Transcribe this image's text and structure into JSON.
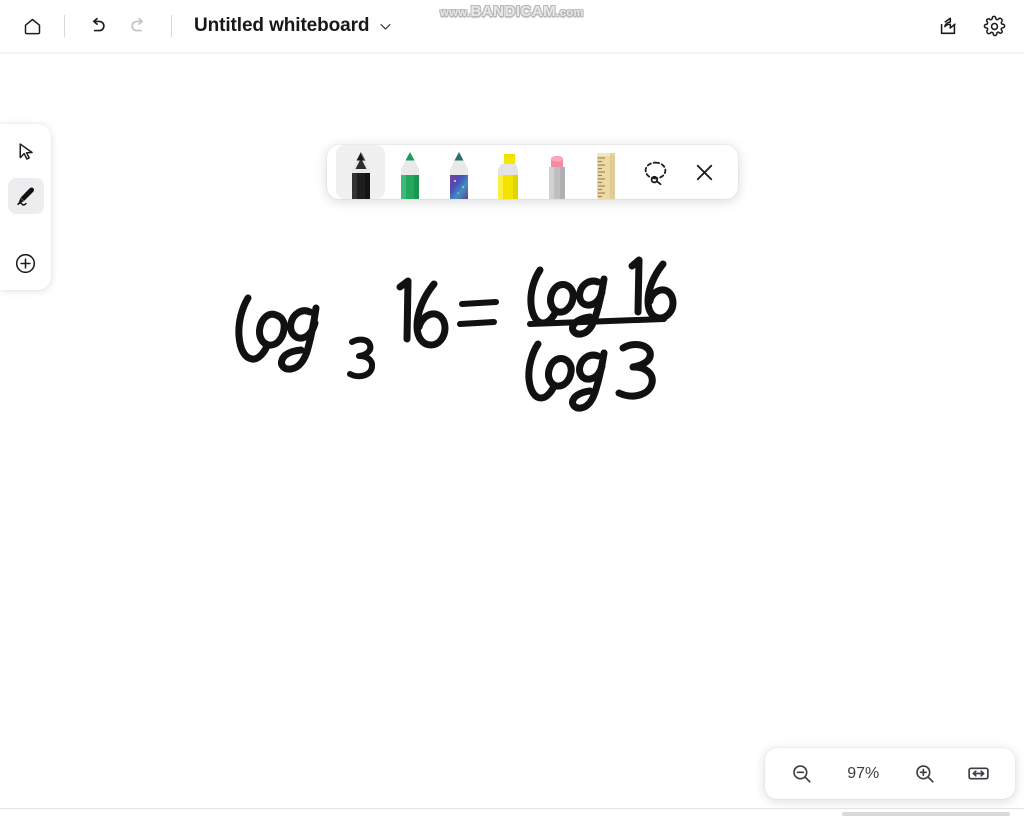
{
  "app": {
    "title": "Untitled whiteboard",
    "background_color": "#ffffff",
    "accent_color": "#18181b"
  },
  "watermark": {
    "prefix": "www.",
    "brand": "BANDICAM",
    "suffix": ".com",
    "full_text": "www.BANDICAM.com"
  },
  "header": {
    "home_label": "Home",
    "undo_label": "Undo",
    "redo_label": "Redo",
    "title": "Untitled whiteboard",
    "title_dropdown_label": "Document menu",
    "share_label": "Share",
    "settings_label": "Settings"
  },
  "sidebar": {
    "items": [
      {
        "name": "select",
        "label": "Select",
        "icon": "cursor-icon",
        "active": false
      },
      {
        "name": "pen",
        "label": "Pen",
        "icon": "pen-icon",
        "active": true
      },
      {
        "name": "add",
        "label": "Add",
        "icon": "plus-circle-icon",
        "active": false
      }
    ]
  },
  "pen_toolbar": {
    "tools": [
      {
        "name": "black-pen",
        "label": "Black pen",
        "type": "pen",
        "color": "#1c1c1c",
        "selected": true
      },
      {
        "name": "green-pen",
        "label": "Green pen",
        "type": "pen",
        "color": "#1f9d55",
        "selected": false
      },
      {
        "name": "galaxy-pen",
        "label": "Galaxy pen",
        "type": "pen",
        "color": "#5b4b9e",
        "selected": false
      },
      {
        "name": "yellow-highlighter",
        "label": "Yellow highlighter",
        "type": "highlighter",
        "color": "#f2e205",
        "selected": false
      },
      {
        "name": "eraser",
        "label": "Eraser",
        "type": "eraser",
        "color": "#f48fa0",
        "selected": false
      },
      {
        "name": "ruler",
        "label": "Ruler",
        "type": "ruler",
        "color": "#e8d4a0",
        "selected": false
      }
    ],
    "lasso_label": "Lasso select",
    "close_label": "Close toolbar"
  },
  "canvas": {
    "ink_color": "#111111",
    "content_description": "handwritten equation",
    "equation_text": "log₃ 16 = log 16 / log 3",
    "equation_parts": {
      "left_base_word": "log",
      "left_subscript": "3",
      "left_argument": "16",
      "equals": "=",
      "numerator": "log 16",
      "denominator": "log 3"
    }
  },
  "zoom_bar": {
    "zoom_out_label": "Zoom out",
    "level": "97%",
    "zoom_in_label": "Zoom in",
    "fit_label": "Fit to screen"
  }
}
